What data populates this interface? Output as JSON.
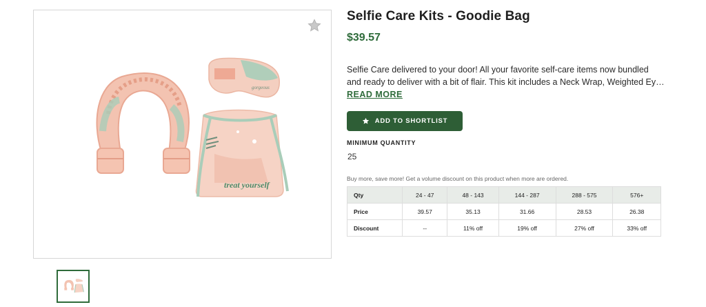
{
  "product": {
    "title": "Selfie Care Kits - Goodie Bag",
    "price": "$39.57",
    "description": "Selfie Care delivered to your door! All your favorite self-care items now bundled and ready to deliver with a bit of flair. This kit includes a Neck Wrap, Weighted Eye Mask,…",
    "read_more_label": "READ MORE",
    "bag_print": "treat yourself",
    "mask_print": "gorgeous"
  },
  "actions": {
    "shortlist_label": "ADD TO SHORTLIST",
    "favorite_icon": "star-icon"
  },
  "minimum_quantity": {
    "label": "MINIMUM QUANTITY",
    "value": "25"
  },
  "volume_note": "Buy more, save more! Get a volume discount on this product when more are ordered.",
  "pricing_table": {
    "header": [
      "Qty",
      "24 - 47",
      "48 - 143",
      "144 - 287",
      "288 - 575",
      "576+"
    ],
    "rows": [
      [
        "Price",
        "39.57",
        "35.13",
        "31.66",
        "28.53",
        "26.38"
      ],
      [
        "Discount",
        "--",
        "11% off",
        "19% off",
        "27% off",
        "33% off"
      ]
    ]
  },
  "colors": {
    "accent": "#2e6b3a",
    "button": "#2e5e36",
    "peach": "#f0b7a4",
    "sage": "#a8cdb8"
  }
}
